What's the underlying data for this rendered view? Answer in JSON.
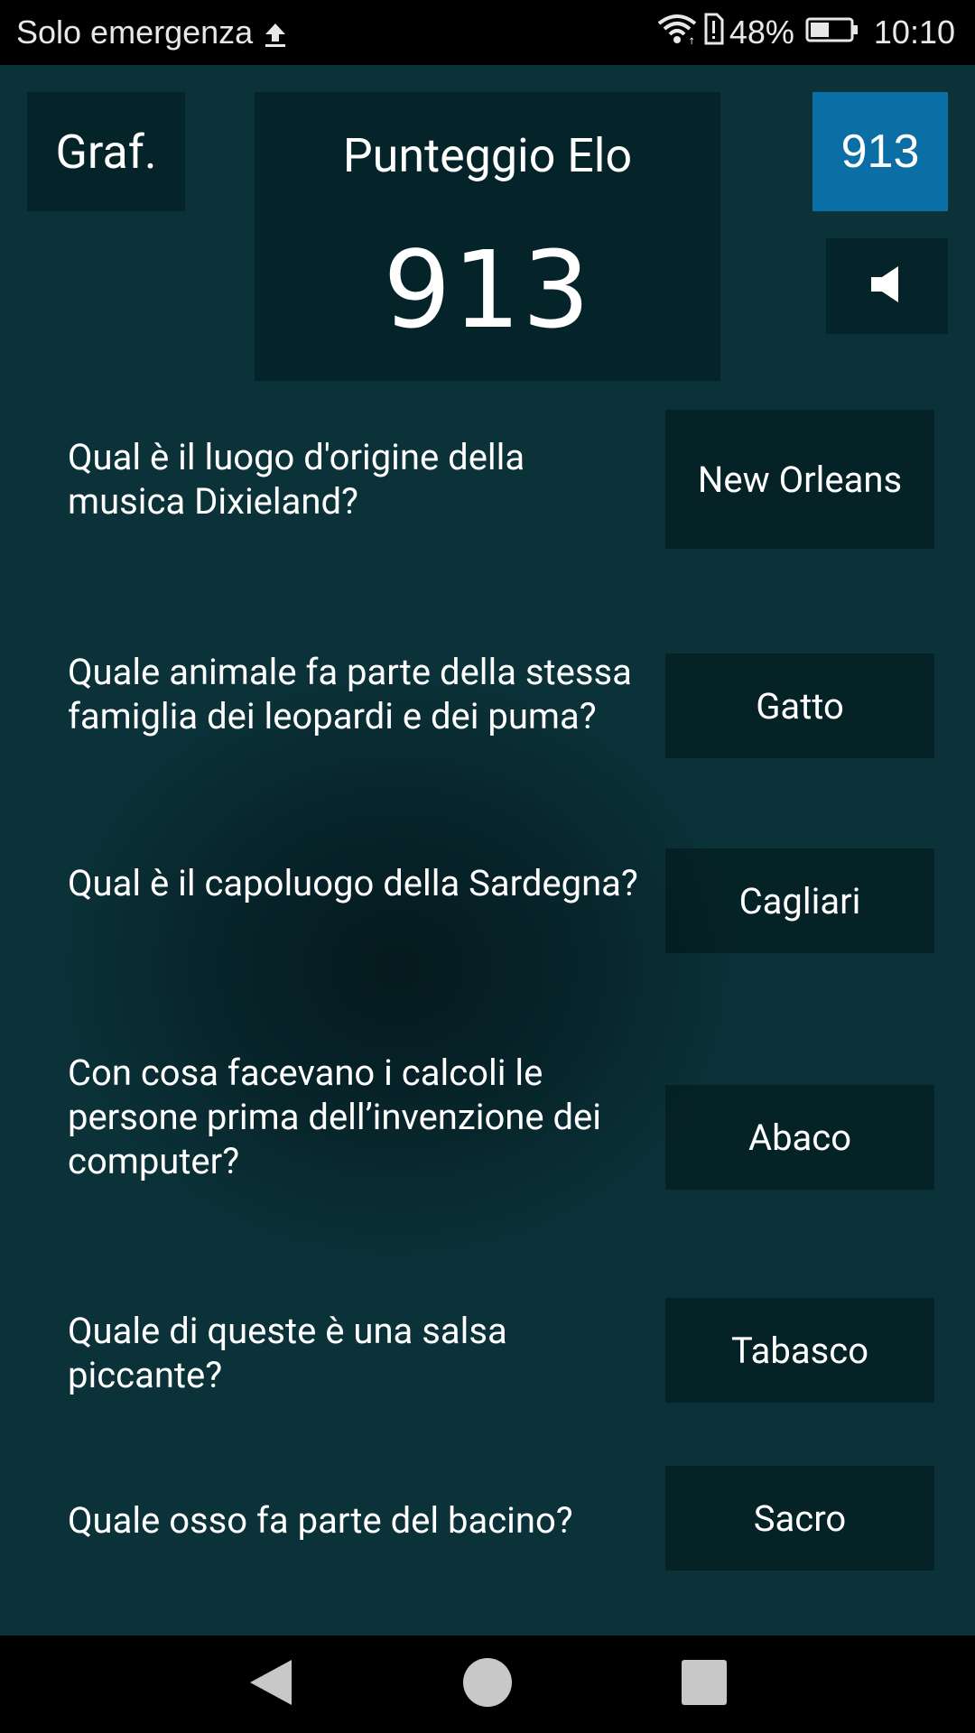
{
  "status_bar": {
    "carrier": "Solo emergenza",
    "battery_percent": "48%",
    "battery_level": 0.48,
    "time": "10:10",
    "icons": [
      "upload-icon",
      "wifi-icon",
      "sim-alert-icon",
      "battery-icon"
    ]
  },
  "header": {
    "graph_button_label": "Graf.",
    "elo_title": "Punteggio Elo",
    "elo_value": "913",
    "score_badge": "913",
    "sound_icon": "speaker-icon"
  },
  "questions": [
    {
      "question": "Qual è il luogo d'origine della musica Dixieland?",
      "answer": "New Orleans"
    },
    {
      "question": "Quale animale fa parte della stessa famiglia dei leopardi e dei puma?",
      "answer": "Gatto"
    },
    {
      "question": "Qual è il capoluogo della Sardegna?",
      "answer": "Cagliari"
    },
    {
      "question": "Con cosa facevano i calcoli le persone prima dell’invenzione dei computer?",
      "answer": "Abaco"
    },
    {
      "question": "Quale di queste è una salsa piccante?",
      "answer": "Tabasco"
    },
    {
      "question": "Quale osso fa parte del bacino?",
      "answer": "Sacro"
    }
  ],
  "nav_bar": {
    "icons": [
      "back-icon",
      "home-icon",
      "recents-icon"
    ]
  },
  "colors": {
    "background": "#0a3238",
    "badge": "#0b6fa6",
    "status_bar": "#000000"
  }
}
